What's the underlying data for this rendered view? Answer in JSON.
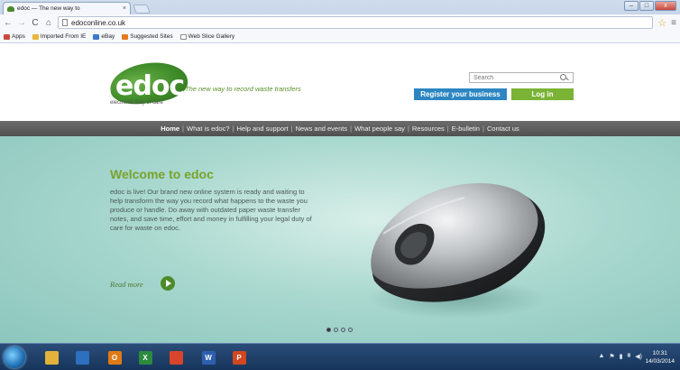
{
  "browser": {
    "tab_title": "edoc — The new way to",
    "tab_close": "×",
    "url": "edoconline.co.uk",
    "window_buttons": {
      "minimize": "–",
      "maximize": "□",
      "close": "x"
    },
    "bookmarks": [
      {
        "label": "Apps",
        "icon": "apps-icon",
        "color": "#c94a3c"
      },
      {
        "label": "Imported From IE",
        "icon": "folder-icon",
        "color": "#e8b63a"
      },
      {
        "label": "eBay",
        "icon": "ebay-icon",
        "color": "#3b7ac9"
      },
      {
        "label": "Suggested Sites",
        "icon": "suggested-icon",
        "color": "#e57a1c"
      },
      {
        "label": "Web Slice Gallery",
        "icon": "page-icon",
        "color": "#ffffff"
      }
    ]
  },
  "site": {
    "logo_text": "edoc",
    "logo_subtitle": "electronic duty of care",
    "tagline": "The new way to record waste transfers",
    "search_placeholder": "Search",
    "register_label": "Register your business",
    "login_label": "Log in",
    "nav": [
      "Home",
      "What is edoc?",
      "Help and support",
      "News and events",
      "What people say",
      "Resources",
      "E-bulletin",
      "Contact us"
    ],
    "nav_active": "Home",
    "hero": {
      "title": "Welcome to edoc",
      "text": "edoc is live! Our brand new online system is ready and waiting to help transform the way you record what happens to the waste you produce or handle. Do away with outdated paper waste transfer notes, and save time, effort and money in fulfilling your legal duty of care for waste on edoc.",
      "read_more": "Read more",
      "slide_count": 4,
      "active_slide": 1
    },
    "colors": {
      "accent_green": "#7ab335",
      "accent_blue": "#2c86c2",
      "title_green": "#78a32c"
    }
  },
  "taskbar": {
    "apps": [
      {
        "name": "explorer",
        "glyph": "",
        "color": "#e2b23a"
      },
      {
        "name": "media",
        "glyph": "",
        "color": "#2e6fbf"
      },
      {
        "name": "outlook",
        "glyph": "O",
        "color": "#e07a16"
      },
      {
        "name": "excel",
        "glyph": "X",
        "color": "#2b8a3e"
      },
      {
        "name": "chrome",
        "glyph": "",
        "color": "#d8452b"
      },
      {
        "name": "word",
        "glyph": "W",
        "color": "#2d5fb0"
      },
      {
        "name": "powerpoint",
        "glyph": "P",
        "color": "#d2471f"
      }
    ],
    "time": "10:31",
    "date": "14/03/2014"
  }
}
